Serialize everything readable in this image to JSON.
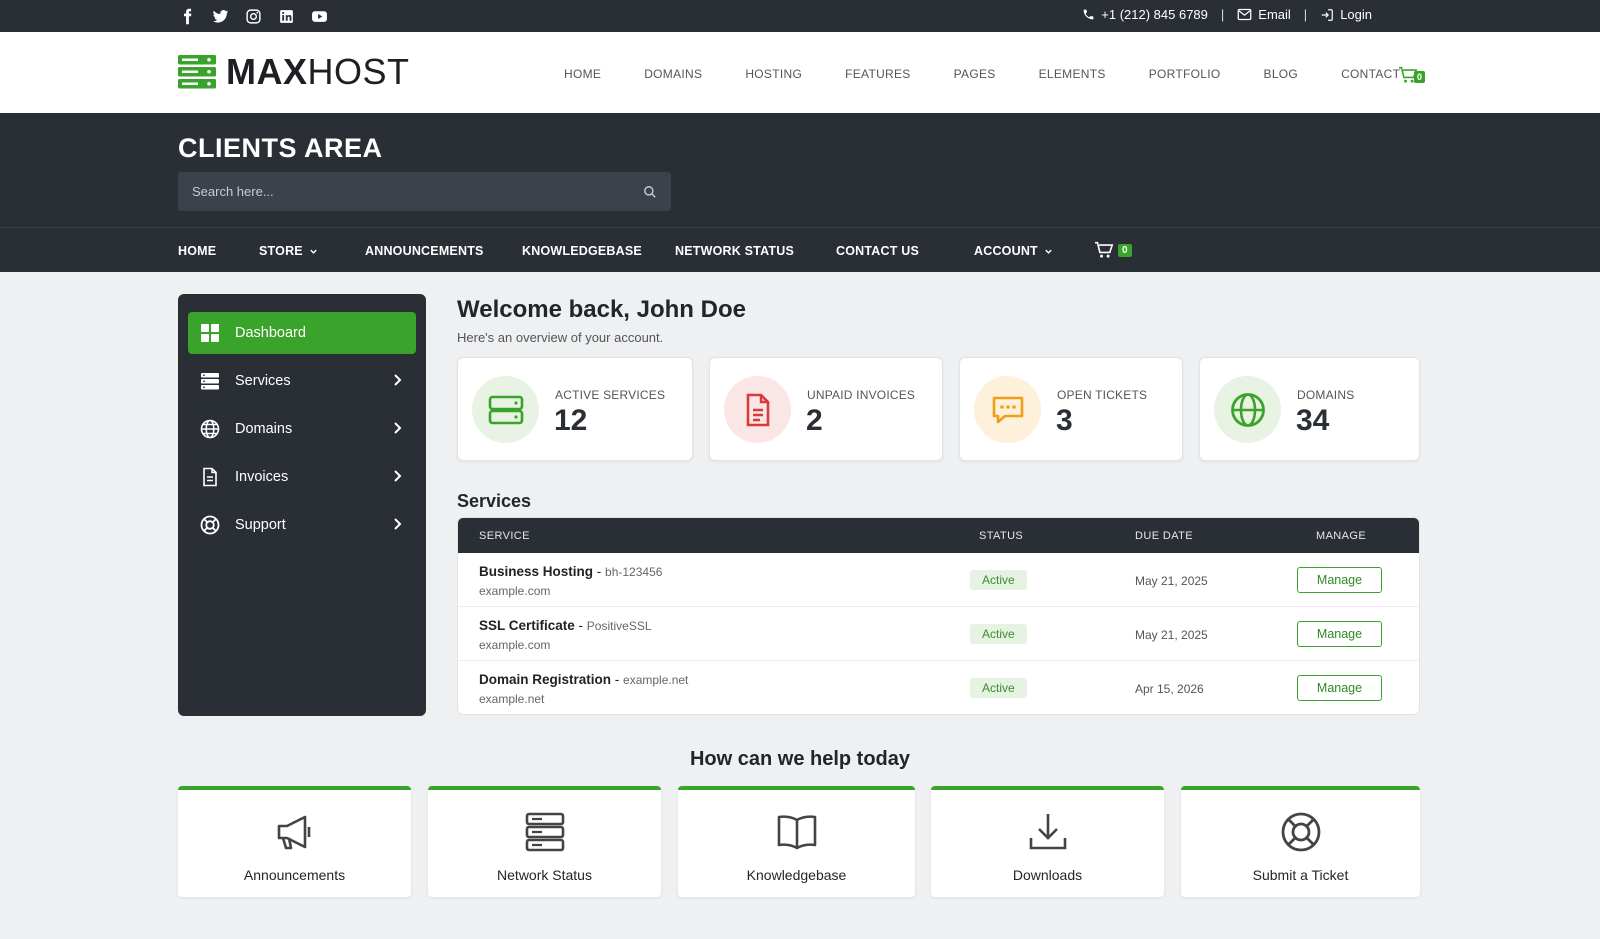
{
  "topbar": {
    "socials": [
      "facebook-icon",
      "twitter-icon",
      "instagram-icon",
      "linkedin-icon",
      "youtube-icon"
    ],
    "phone": "+1 (212) 845 6789",
    "email": "Email",
    "login": "Login"
  },
  "header": {
    "logo_bold": "MAX",
    "logo_light": "HOST",
    "nav": [
      "HOME",
      "DOMAINS",
      "HOSTING",
      "FEATURES",
      "PAGES",
      "ELEMENTS",
      "PORTFOLIO",
      "BLOG",
      "CONTACT"
    ],
    "cart_count": "0"
  },
  "hero": {
    "title": "CLIENTS AREA",
    "search_placeholder": "Search here..."
  },
  "subnav": {
    "home": "HOME",
    "store": "STORE",
    "announcements": "ANNOUNCEMENTS",
    "knowledgebase": "KNOWLEDGEBASE",
    "network_status": "NETWORK STATUS",
    "contact_us": "CONTACT US",
    "account": "ACCOUNT",
    "cart_count": "0"
  },
  "sidebar": {
    "items": [
      {
        "label": "Dashboard"
      },
      {
        "label": "Services"
      },
      {
        "label": "Domains"
      },
      {
        "label": "Invoices"
      },
      {
        "label": "Support"
      }
    ]
  },
  "main": {
    "welcome": "Welcome back, John Doe",
    "subtitle": "Here's an overview of your account.",
    "stats": [
      {
        "label": "ACTIVE SERVICES",
        "value": "12"
      },
      {
        "label": "UNPAID INVOICES",
        "value": "2"
      },
      {
        "label": "OPEN TICKETS",
        "value": "3"
      },
      {
        "label": "DOMAINS",
        "value": "34"
      }
    ],
    "services_title": "Services",
    "table": {
      "headers": {
        "service": "SERVICE",
        "status": "STATUS",
        "due": "DUE DATE",
        "manage": "MANAGE"
      },
      "rows": [
        {
          "name": "Business Hosting",
          "sep": " - ",
          "sub": "bh-123456",
          "domain": "example.com",
          "status": "Active",
          "due": "May 21, 2025",
          "action": "Manage"
        },
        {
          "name": "SSL Certificate",
          "sep": " - ",
          "sub": "PositiveSSL",
          "domain": "example.com",
          "status": "Active",
          "due": "May 21, 2025",
          "action": "Manage"
        },
        {
          "name": "Domain Registration",
          "sep": " - ",
          "sub": "example.net",
          "domain": "example.net",
          "status": "Active",
          "due": "Apr 15, 2026",
          "action": "Manage"
        }
      ]
    },
    "help_title": "How can we help today",
    "help": [
      {
        "label": "Announcements"
      },
      {
        "label": "Network Status"
      },
      {
        "label": "Knowledgebase"
      },
      {
        "label": "Downloads"
      },
      {
        "label": "Submit a Ticket"
      }
    ]
  },
  "colors": {
    "accent": "#3aa32b",
    "dark": "#2a2e35",
    "invoice_red": "#d93a3a",
    "ticket_orange": "#f0a017"
  }
}
